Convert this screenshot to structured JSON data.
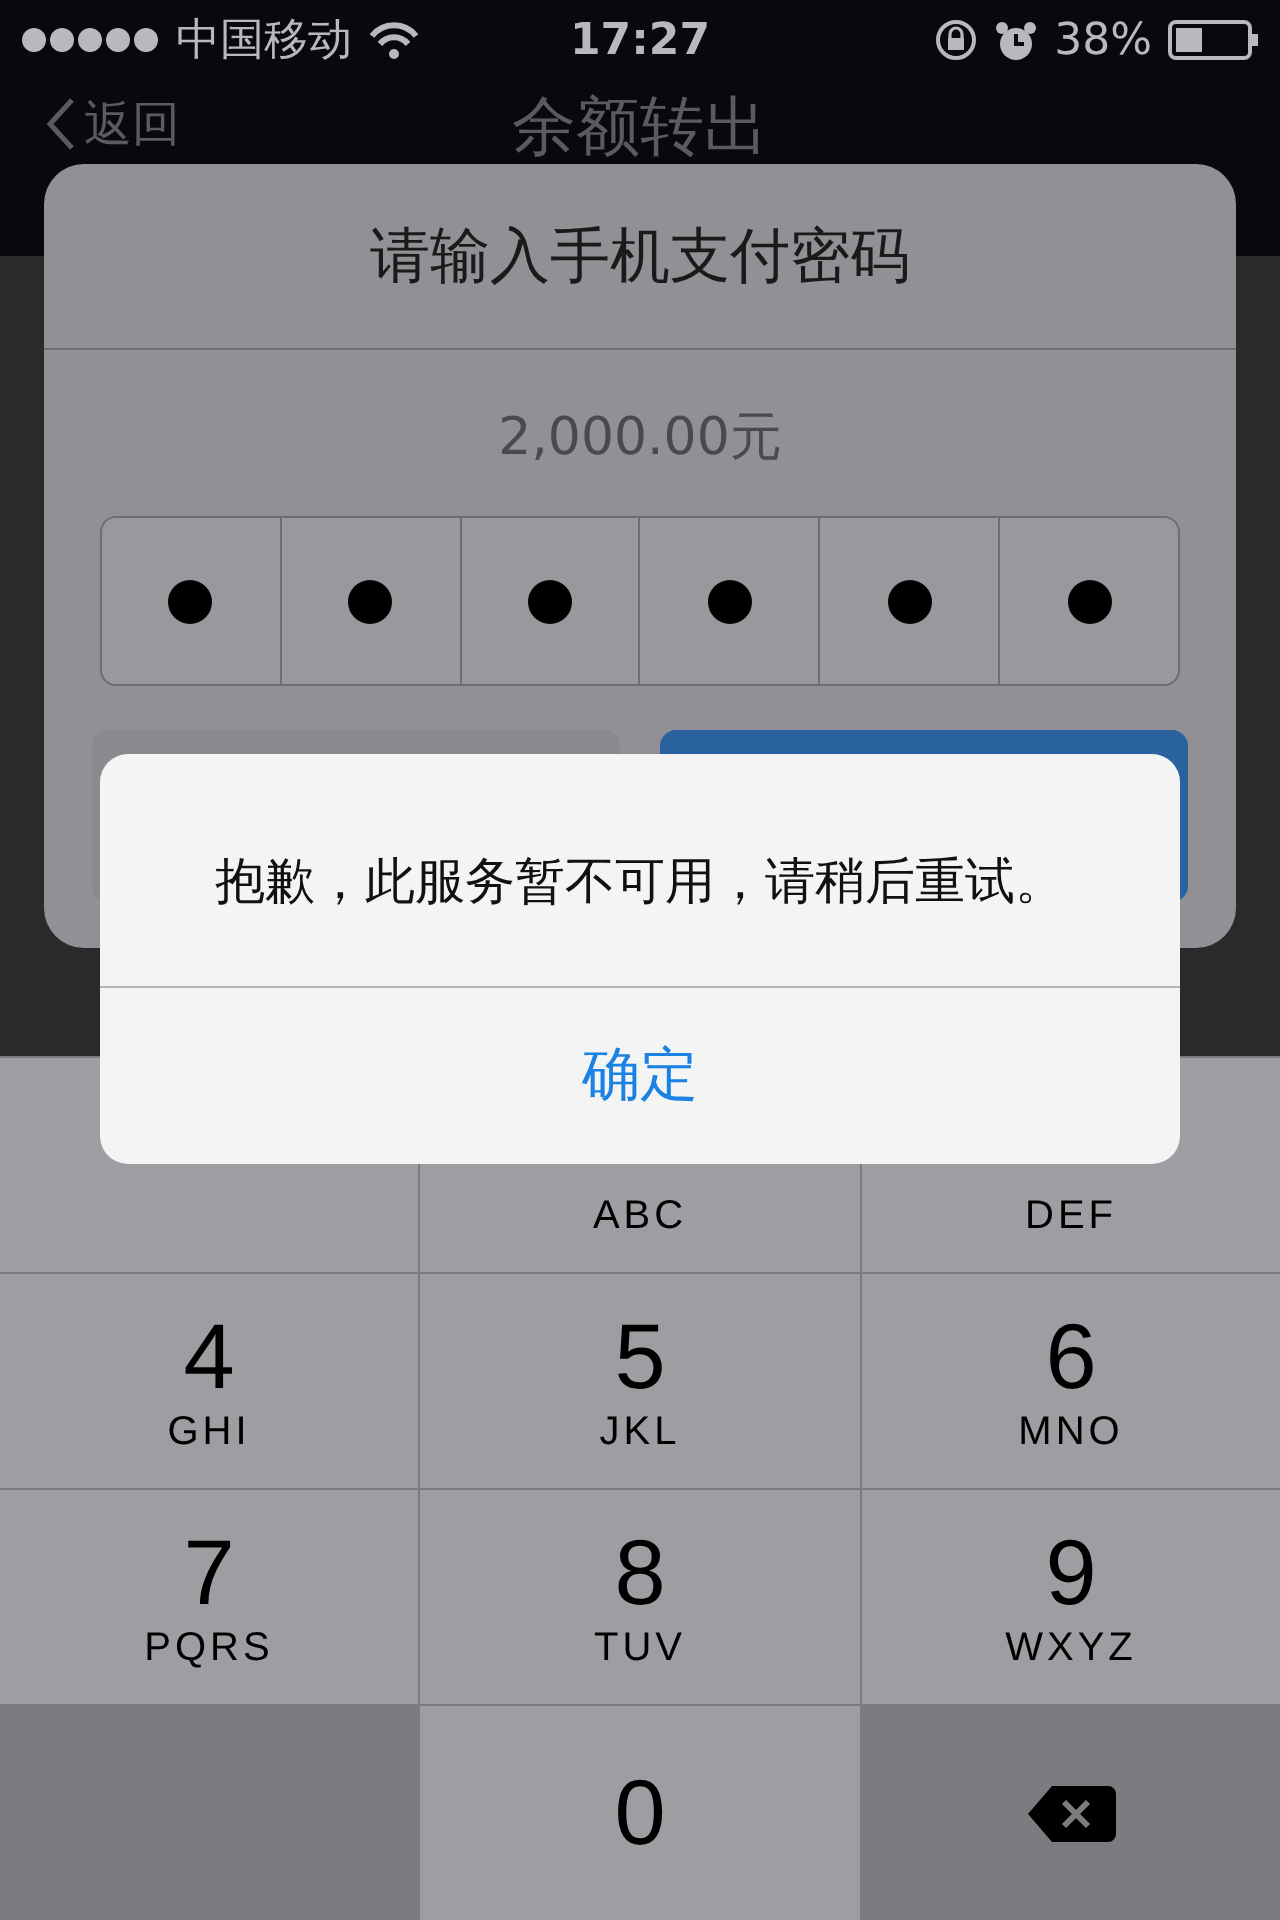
{
  "status_bar": {
    "carrier": "中国移动",
    "time": "17:27",
    "battery": "38%"
  },
  "nav": {
    "back": "返回",
    "title": "余额转出"
  },
  "pay_dialog": {
    "title": "请输入手机支付密码",
    "amount": "2,000.00元",
    "pin": [
      {
        "filled": true
      },
      {
        "filled": true
      },
      {
        "filled": true
      },
      {
        "filled": true
      },
      {
        "filled": true
      },
      {
        "filled": true
      }
    ],
    "buttons": [
      {
        "kind": "cancel"
      },
      {
        "kind": "primary"
      }
    ]
  },
  "alert": {
    "message": "抱歉，此服务暂不可用，请稍后重试。",
    "button": "确定"
  },
  "keyboard": [
    {
      "kind": "digit"
    },
    {
      "kind": "digit",
      "letters": "ABC"
    },
    {
      "kind": "digit",
      "letters": "DEF"
    },
    {
      "kind": "digit",
      "digit": "4",
      "letters": "GHI"
    },
    {
      "kind": "digit",
      "digit": "5",
      "letters": "JKL"
    },
    {
      "kind": "digit",
      "digit": "6",
      "letters": "MNO"
    },
    {
      "kind": "digit",
      "digit": "7",
      "letters": "PQRS"
    },
    {
      "kind": "digit",
      "digit": "8",
      "letters": "TUV"
    },
    {
      "kind": "digit",
      "digit": "9",
      "letters": "WXYZ"
    },
    {
      "kind": "blank"
    },
    {
      "kind": "digit",
      "digit": "0"
    },
    {
      "kind": "delete"
    }
  ]
}
